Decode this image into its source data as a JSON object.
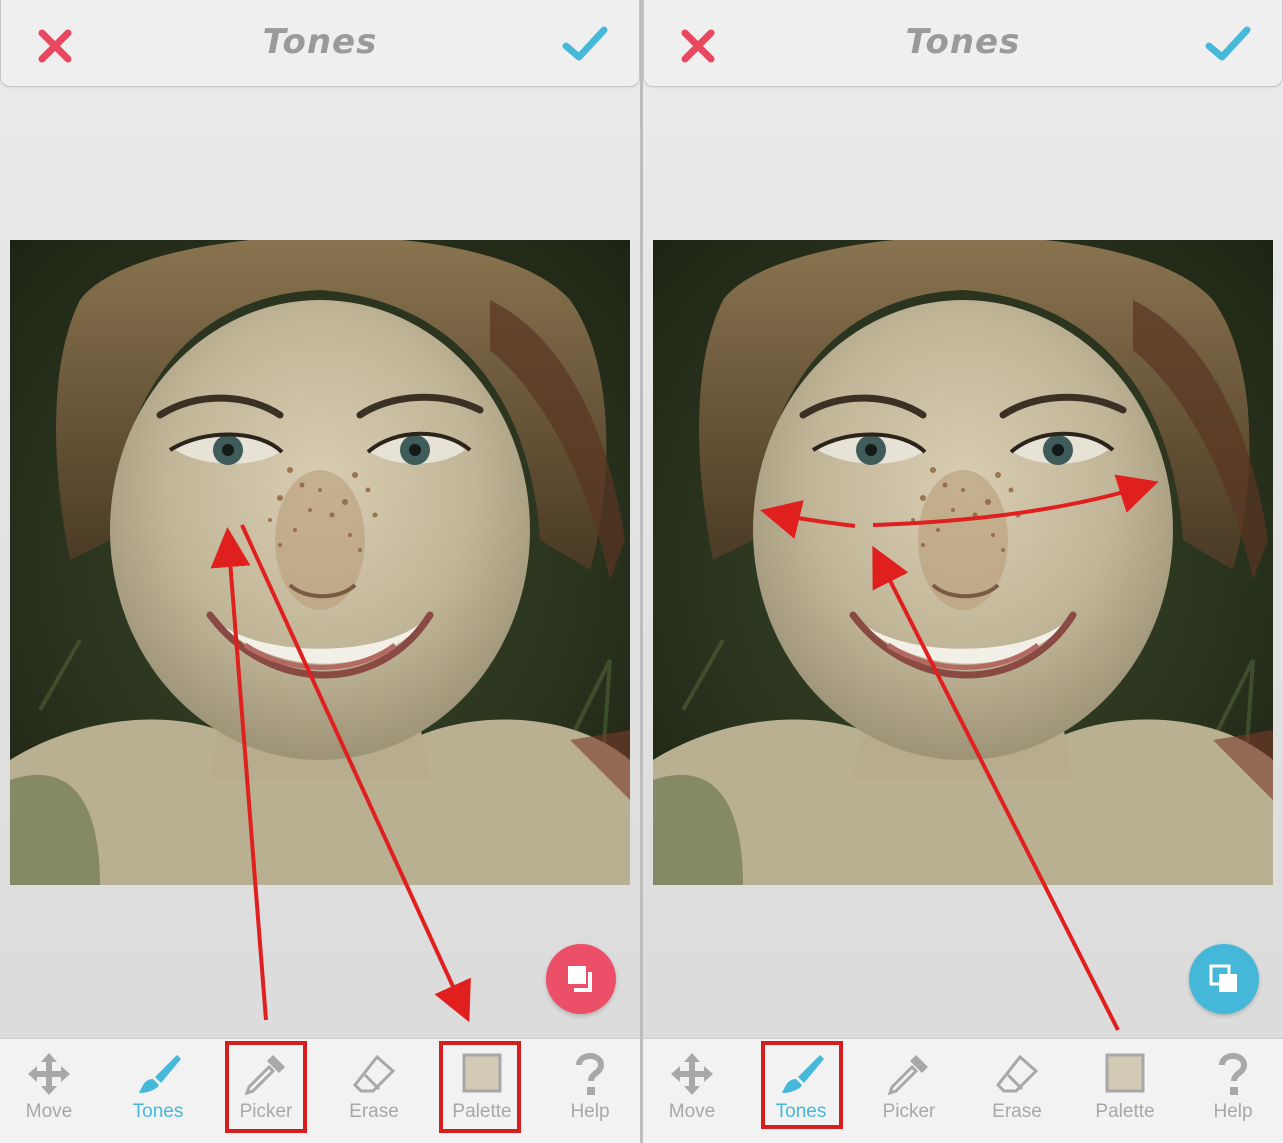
{
  "colors": {
    "close_red": "#e8485f",
    "accent_blue": "#46b9da",
    "inactive_gray": "#a8a8a8",
    "annotation_red": "#e01f1f"
  },
  "left_panel": {
    "title": "Tones",
    "fab_icon": "compare-icon",
    "fab_color": "#ec4f68",
    "tools": [
      {
        "label": "Move",
        "icon": "move-icon"
      },
      {
        "label": "Tones",
        "icon": "brush-icon"
      },
      {
        "label": "Picker",
        "icon": "eyedropper-icon"
      },
      {
        "label": "Erase",
        "icon": "eraser-icon"
      },
      {
        "label": "Palette",
        "icon": "palette-swatch-icon"
      },
      {
        "label": "Help",
        "icon": "help-icon"
      }
    ]
  },
  "right_panel": {
    "title": "Tones",
    "fab_icon": "compare-icon",
    "fab_color": "#45b8d9",
    "tools": [
      {
        "label": "Move",
        "icon": "move-icon"
      },
      {
        "label": "Tones",
        "icon": "brush-icon"
      },
      {
        "label": "Picker",
        "icon": "eyedropper-icon"
      },
      {
        "label": "Erase",
        "icon": "eraser-icon"
      },
      {
        "label": "Palette",
        "icon": "palette-swatch-icon"
      },
      {
        "label": "Help",
        "icon": "help-icon"
      }
    ]
  }
}
